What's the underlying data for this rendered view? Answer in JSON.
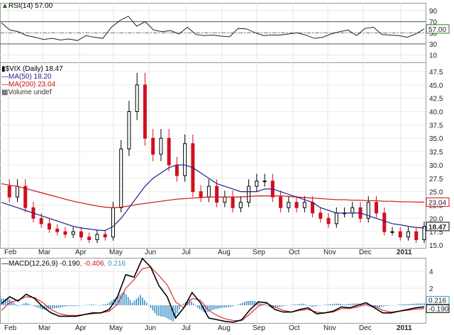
{
  "chart_data": {
    "type": "line",
    "title": "$VIX (Daily) 18.47",
    "months": [
      "Feb",
      "Mar",
      "Apr",
      "May",
      "Jun",
      "Jul",
      "Aug",
      "Sep",
      "Oct",
      "Nov",
      "Dec",
      "2011"
    ],
    "rsi": {
      "label": "RSI(14) 57.00",
      "ticks": [
        "90",
        "70",
        "50",
        "30",
        "10"
      ],
      "last": "57.00",
      "ylim": [
        0,
        100
      ],
      "values": [
        68,
        55,
        52,
        45,
        42,
        38,
        40,
        37,
        39,
        36,
        45,
        42,
        40,
        60,
        72,
        80,
        62,
        70,
        55,
        52,
        54,
        48,
        60,
        47,
        45,
        46,
        44,
        43,
        58,
        57,
        50,
        45,
        46,
        46,
        48,
        50,
        46,
        40,
        42,
        48,
        52,
        55,
        45,
        58,
        60,
        47,
        46,
        45,
        42,
        48,
        57
      ]
    },
    "price": {
      "ticks": [
        "47.5",
        "45.0",
        "42.5",
        "40.0",
        "37.5",
        "35.0",
        "32.5",
        "30.0",
        "27.5",
        "25.0",
        "22.5",
        "20.0",
        "17.5",
        "15.0"
      ],
      "ylim": [
        15,
        48.5
      ],
      "legend": {
        "main": "$VIX (Daily) 18.47",
        "ma50": "MA(50) 18.20",
        "ma200": "MA(200) 23.04",
        "volume": "Volume undef"
      },
      "last": "18.47",
      "ma200_last": "23.04",
      "close": [
        26,
        24,
        26,
        22,
        20,
        19,
        18,
        17.5,
        17,
        17.5,
        16.5,
        16,
        17,
        16.5,
        22,
        33,
        40,
        45,
        35,
        32,
        35,
        30,
        28,
        34,
        25,
        24,
        26,
        23,
        24,
        22,
        23,
        26,
        27,
        27,
        24,
        22,
        23,
        22,
        23,
        21,
        20,
        19,
        21,
        21,
        22,
        20,
        23,
        21,
        17.5,
        17.5,
        16.5,
        17.5,
        16,
        18.5
      ],
      "ma50": [
        23,
        22.5,
        22,
        21.5,
        21,
        20.5,
        20,
        19.5,
        19,
        18.5,
        18.2,
        18,
        17.8,
        17.7,
        18.5,
        20,
        22,
        24,
        26,
        27.5,
        28.5,
        29.5,
        30,
        30,
        29.5,
        28.5,
        27.5,
        26.5,
        26,
        25.5,
        25,
        25,
        25,
        25.5,
        25.5,
        25,
        24.5,
        24,
        23.5,
        23,
        22,
        21.5,
        21,
        21,
        21,
        21,
        20.5,
        20,
        19.5,
        19,
        18.8,
        18.5,
        18.3,
        18.2
      ],
      "ma200": [
        26.5,
        26.2,
        26,
        25.6,
        25.2,
        24.8,
        24.4,
        24,
        23.6,
        23.2,
        22.9,
        22.6,
        22.3,
        22.1,
        22,
        22.1,
        22.3,
        22.6,
        22.8,
        23,
        23.2,
        23.4,
        23.6,
        23.7,
        23.8,
        23.9,
        24,
        24,
        24,
        24,
        24,
        24.1,
        24.2,
        24.2,
        24.2,
        24.2,
        24.1,
        24,
        23.9,
        23.8,
        23.7,
        23.6,
        23.5,
        23.5,
        23.4,
        23.4,
        23.3,
        23.3,
        23.2,
        23.2,
        23.1,
        23.1,
        23.05,
        23.04
      ]
    },
    "macd": {
      "label": "MACD(12,26,9) -0.190",
      "signal_label": ", -0.406",
      "hist_label": ", 0.216",
      "ticks": [
        "4",
        "2"
      ],
      "ylim": [
        -2.5,
        5
      ],
      "hist_last": "0.216",
      "macd_last": "-0.190",
      "macd": [
        0.2,
        1,
        0.5,
        1.3,
        0.8,
        -0.2,
        -0.9,
        -1.3,
        -1.3,
        -1.3,
        -1.1,
        -0.9,
        -0.9,
        -0.5,
        1,
        3.6,
        3.3,
        5.5,
        4.5,
        2.3,
        1,
        -1.5,
        -0.3,
        1.5,
        0.3,
        -1.5,
        -1.7,
        -1.9,
        -2,
        -1.7,
        -0.5,
        0.4,
        0.3,
        -0.5,
        -0.8,
        -0.8,
        -0.5,
        -0.3,
        -1,
        -0.9,
        -0.7,
        -0.2,
        -0.3,
        0,
        0.3,
        -0.3,
        -0.9,
        -0.9,
        -0.7,
        -0.5,
        -0.3,
        -0.19
      ],
      "signal": [
        -0.6,
        0.3,
        0.6,
        1,
        0.9,
        0.3,
        -0.5,
        -1,
        -1.2,
        -1.2,
        -1.1,
        -1,
        -0.9,
        -0.7,
        0.1,
        2,
        3,
        4.3,
        4.5,
        3.5,
        2.4,
        0.4,
        -0.3,
        0.8,
        0.6,
        -0.6,
        -1.2,
        -1.6,
        -1.8,
        -1.8,
        -1,
        -0.1,
        0.2,
        -0.2,
        -0.6,
        -0.8,
        -0.6,
        -0.5,
        -0.8,
        -0.9,
        -0.8,
        -0.4,
        -0.4,
        -0.2,
        0.1,
        -0.1,
        -0.6,
        -0.8,
        -0.7,
        -0.6,
        -0.45,
        -0.406
      ],
      "hist": [
        0.8,
        0.7,
        -0.1,
        0.3,
        -0.1,
        -0.5,
        -0.4,
        -0.3,
        -0.1,
        -0.1,
        0,
        0.1,
        0,
        0.2,
        0.9,
        1.6,
        0.3,
        1.2,
        0,
        -1.2,
        -1.4,
        -1.9,
        0,
        0.7,
        -0.3,
        -0.9,
        -0.5,
        -0.3,
        -0.2,
        0.1,
        0.5,
        0.5,
        0.1,
        -0.3,
        -0.2,
        0,
        0.1,
        0.2,
        -0.2,
        0,
        0.1,
        0.2,
        0.1,
        0.2,
        0.2,
        -0.2,
        -0.3,
        -0.1,
        0,
        0.1,
        0.15,
        0.216
      ]
    }
  }
}
